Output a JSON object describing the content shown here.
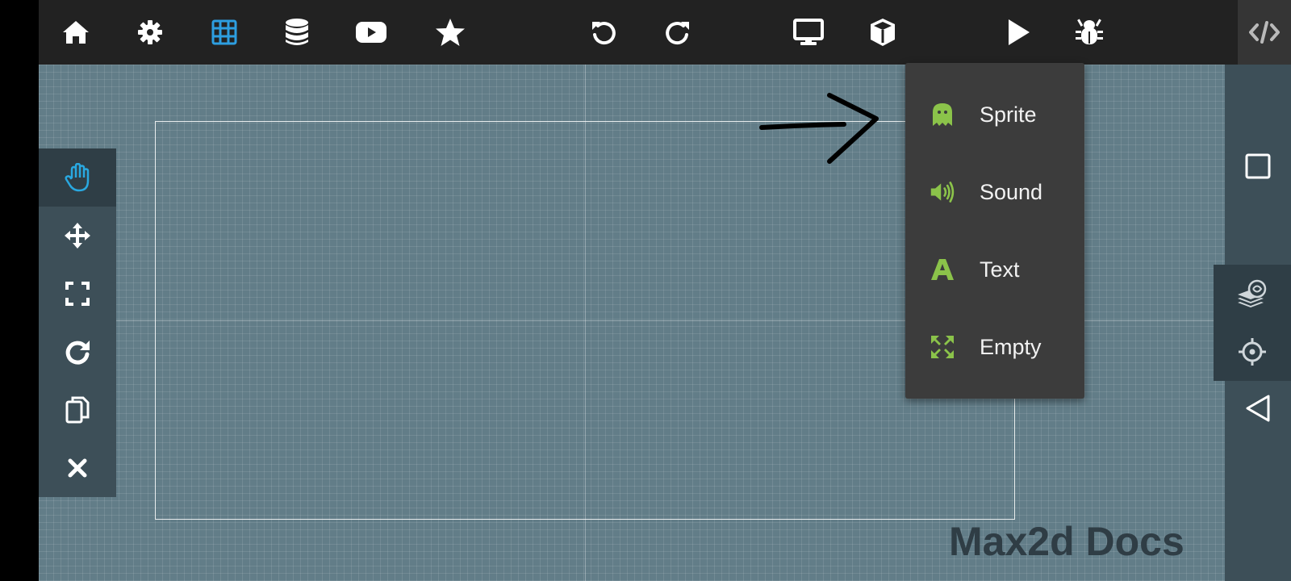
{
  "toolbar": {
    "items": [
      {
        "icon": "home-icon"
      },
      {
        "icon": "gear-icon"
      },
      {
        "icon": "grid-icon",
        "active": true,
        "color": "#2d9ee0"
      },
      {
        "icon": "database-icon"
      },
      {
        "icon": "youtube-icon"
      },
      {
        "icon": "star-icon"
      },
      {
        "icon": "undo-icon"
      },
      {
        "icon": "redo-icon"
      },
      {
        "icon": "monitor-icon"
      },
      {
        "icon": "cube-icon"
      },
      {
        "icon": "play-icon"
      },
      {
        "icon": "bug-icon"
      },
      {
        "icon": "code-icon"
      }
    ]
  },
  "left_tools": {
    "items": [
      {
        "icon": "hand-icon",
        "active": true,
        "color": "#29a8e0"
      },
      {
        "icon": "move-icon"
      },
      {
        "icon": "scale-icon"
      },
      {
        "icon": "rotate-icon"
      },
      {
        "icon": "copy-icon"
      },
      {
        "icon": "delete-icon"
      }
    ]
  },
  "right_tools": {
    "items": [
      {
        "icon": "square-icon"
      },
      {
        "icon": "layers-icon"
      },
      {
        "icon": "crosshair-icon"
      },
      {
        "icon": "back-triangle-icon"
      }
    ]
  },
  "add_menu": {
    "accent_color": "#8bc34a",
    "items": [
      {
        "label": "Sprite",
        "icon": "ghost-icon"
      },
      {
        "label": "Sound",
        "icon": "speaker-icon"
      },
      {
        "label": "Text",
        "icon": "text-icon"
      },
      {
        "label": "Empty",
        "icon": "expand-arrows-icon"
      }
    ]
  },
  "annotation": {
    "icon": "hand-drawn-arrow-icon"
  },
  "watermark": {
    "text": "Max2d Docs"
  },
  "colors": {
    "topbar": "#222222",
    "canvas": "#627d88",
    "side_panel": "#3d4f58",
    "menu": "#3c3c3c",
    "active_blue": "#29a8e0",
    "menu_green": "#8bc34a"
  }
}
